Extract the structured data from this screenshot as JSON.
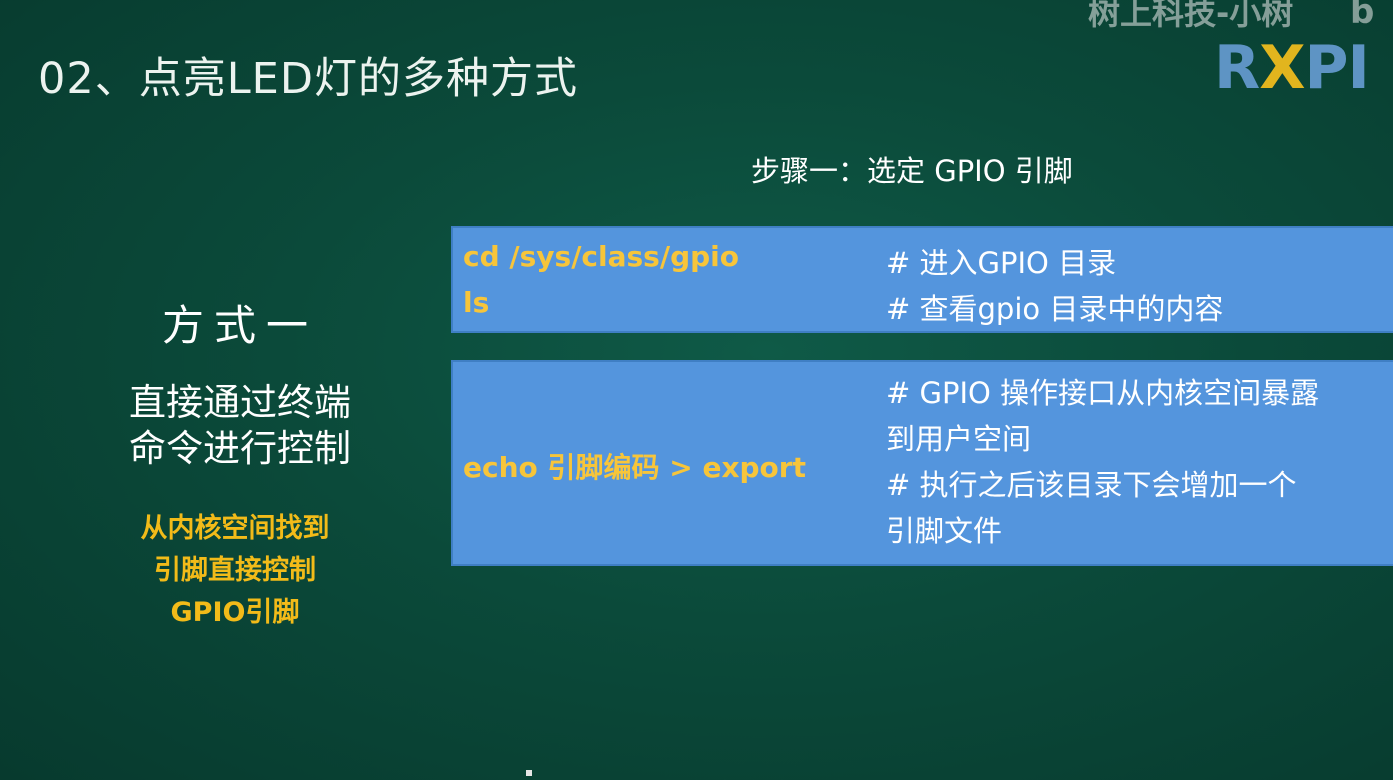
{
  "slide": {
    "title": "02、点亮LED灯的多种方式",
    "watermark": "树上科技-小树",
    "watermark_glyph": "b",
    "logo": {
      "part1": "R",
      "part2": "X",
      "part3": "PI"
    },
    "step_heading": "步骤一：选定 GPIO 引脚"
  },
  "method": {
    "title": "方式一",
    "desc_line1": "直接通过终端",
    "desc_line2": "命令进行控制",
    "note_line1": "从内核空间找到",
    "note_line2": "引脚直接控制",
    "note_line3": "GPIO引脚"
  },
  "box1": {
    "cmd1": "cd /sys/class/gpio",
    "cmd2": "ls",
    "comment1": "# 进入GPIO 目录",
    "comment2": "# 查看gpio 目录中的内容"
  },
  "box2": {
    "cmd": "echo 引脚编码 > export",
    "comment_line1": "# GPIO 操作接口从内核空间暴露",
    "comment_line2": "到用户空间",
    "comment_line3": "# 执行之后该目录下会增加一个",
    "comment_line4": "引脚文件"
  },
  "colors": {
    "background": "#0b4a3a",
    "box": "#5495dd",
    "code": "#f7c53a",
    "note": "#f2bb19"
  }
}
